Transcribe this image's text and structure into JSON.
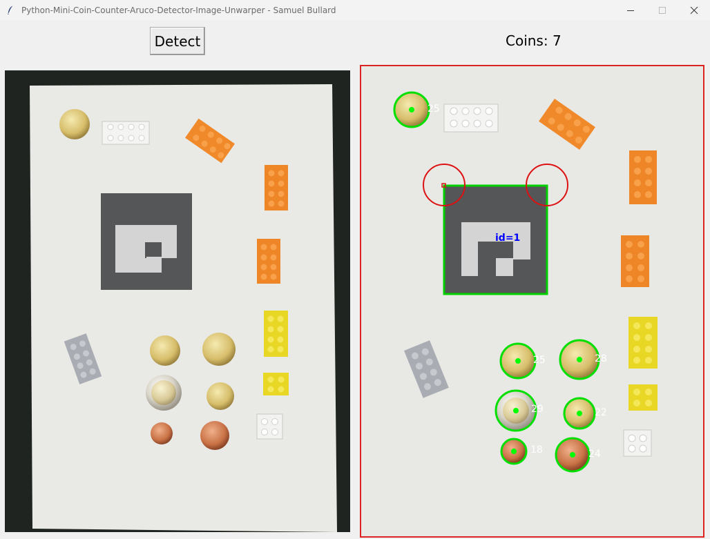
{
  "window": {
    "title": "Python-Mini-Coin-Counter-Aruco-Detector-Image-Unwarper - Samuel Bullard",
    "controls": {
      "minimize": "minimize-icon",
      "maximize": "maximize-icon",
      "close": "close-icon"
    }
  },
  "toolbar": {
    "detect_label": "Detect"
  },
  "status": {
    "coins_label": "Coins: 7"
  },
  "detection": {
    "marker_label": "id=1",
    "coin_labels": [
      "25",
      "25",
      "28",
      "29",
      "22",
      "18",
      "24"
    ]
  },
  "colors": {
    "detection_circle": "#00e000",
    "aruco_outline": "#00d000",
    "reference_circle": "#dd1111",
    "marker_label": "#0000ff",
    "coin_label": "#ffffff",
    "border": "#dd2222"
  }
}
